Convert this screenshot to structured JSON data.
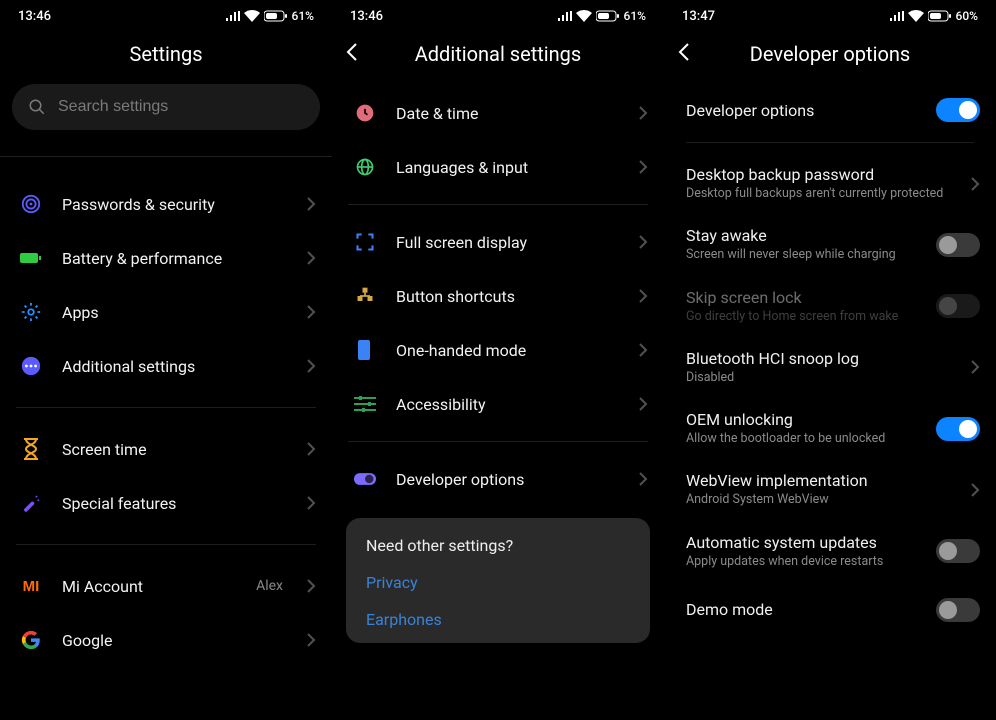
{
  "pane1": {
    "time": "13:46",
    "battery_text": "61",
    "title": "Settings",
    "search_placeholder": "Search settings",
    "items": [
      {
        "label": "Passwords & security",
        "icon": "shield"
      },
      {
        "label": "Battery & performance",
        "icon": "battery"
      },
      {
        "label": "Apps",
        "icon": "gear"
      },
      {
        "label": "Additional settings",
        "icon": "dots"
      }
    ],
    "items2": [
      {
        "label": "Screen time",
        "icon": "hourglass"
      },
      {
        "label": "Special features",
        "icon": "wand"
      }
    ],
    "items3": [
      {
        "label": "Mi Account",
        "icon": "mi",
        "value": "Alex"
      },
      {
        "label": "Google",
        "icon": "google"
      }
    ]
  },
  "pane2": {
    "time": "13:46",
    "battery_text": "61",
    "title": "Additional settings",
    "groupA": [
      {
        "label": "Date & time",
        "icon": "clock"
      },
      {
        "label": "Languages & input",
        "icon": "globe"
      }
    ],
    "groupB": [
      {
        "label": "Full screen display",
        "icon": "fullscreen"
      },
      {
        "label": "Button shortcuts",
        "icon": "buttons"
      },
      {
        "label": "One-handed mode",
        "icon": "phone"
      },
      {
        "label": "Accessibility",
        "icon": "sliders"
      }
    ],
    "groupC": [
      {
        "label": "Developer options",
        "icon": "devtoggle"
      }
    ],
    "card": {
      "title": "Need other settings?",
      "links": [
        "Privacy",
        "Earphones"
      ]
    }
  },
  "pane3": {
    "time": "13:47",
    "battery_text": "60",
    "title": "Developer options",
    "rows": [
      {
        "title": "Developer options",
        "sub": "",
        "control": "toggle-on"
      },
      {
        "divider": true
      },
      {
        "title": "Desktop backup password",
        "sub": "Desktop full backups aren't currently protected",
        "control": "chev"
      },
      {
        "title": "Stay awake",
        "sub": "Screen will never sleep while charging",
        "control": "toggle-off"
      },
      {
        "title": "Skip screen lock",
        "sub": "Go directly to Home screen from wake",
        "control": "toggle-off",
        "disabled": true
      },
      {
        "title": "Bluetooth HCI snoop log",
        "sub": "Disabled",
        "control": "chev"
      },
      {
        "title": "OEM unlocking",
        "sub": "Allow the bootloader to be unlocked",
        "control": "toggle-on"
      },
      {
        "title": "WebView implementation",
        "sub": "Android System WebView",
        "control": "chev"
      },
      {
        "title": "Automatic system updates",
        "sub": "Apply updates when device restarts",
        "control": "toggle-off"
      },
      {
        "title": "Demo mode",
        "sub": "",
        "control": "toggle-off"
      }
    ]
  },
  "percent_sign": "%"
}
